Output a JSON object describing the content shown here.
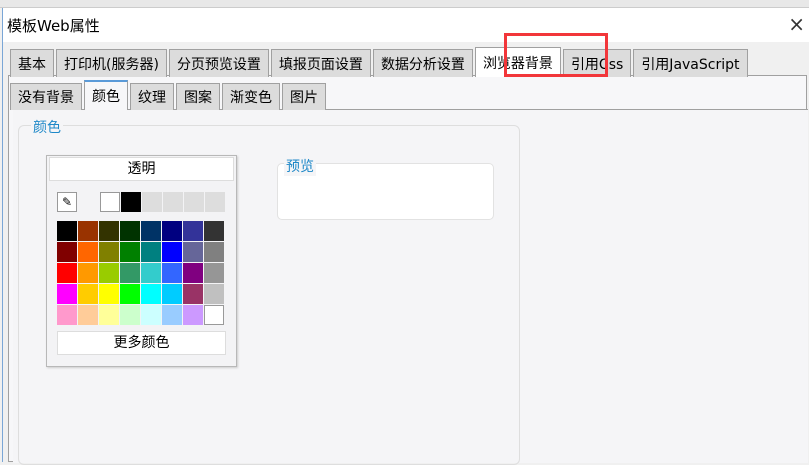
{
  "window": {
    "title": "模板Web属性",
    "close_icon": "×"
  },
  "outer_tabs": [
    {
      "label": "基本"
    },
    {
      "label": "打印机(服务器)"
    },
    {
      "label": "分页预览设置"
    },
    {
      "label": "填报页面设置"
    },
    {
      "label": "数据分析设置"
    },
    {
      "label": "浏览器背景",
      "active": true
    },
    {
      "label": "引用Css"
    },
    {
      "label": "引用JavaScript"
    }
  ],
  "inner_tabs": [
    {
      "label": "没有背景"
    },
    {
      "label": "颜色",
      "active": true
    },
    {
      "label": "纹理"
    },
    {
      "label": "图案"
    },
    {
      "label": "渐变色"
    },
    {
      "label": "图片"
    }
  ],
  "color_group": {
    "label": "颜色"
  },
  "picker": {
    "transparent_label": "透明",
    "eyedropper_icon": "eyedropper-icon",
    "recent_colors": [
      "#FFFFFF",
      "#000000",
      "#DDDDDD",
      "#DDDDDD",
      "#DDDDDD",
      "#DDDDDD"
    ],
    "palette": [
      "#000000",
      "#993300",
      "#333300",
      "#003300",
      "#003366",
      "#000080",
      "#333399",
      "#333333",
      "#800000",
      "#FF6600",
      "#808000",
      "#008000",
      "#008080",
      "#0000FF",
      "#666699",
      "#808080",
      "#FF0000",
      "#FF9900",
      "#99CC00",
      "#339966",
      "#33CCCC",
      "#3366FF",
      "#800080",
      "#969696",
      "#FF00FF",
      "#FFCC00",
      "#FFFF00",
      "#00FF00",
      "#00FFFF",
      "#00CCFF",
      "#993366",
      "#C0C0C0",
      "#FF99CC",
      "#FFCC99",
      "#FFFF99",
      "#CCFFCC",
      "#CCFFFF",
      "#99CCFF",
      "#CC99FF",
      "#FFFFFF"
    ],
    "more_label": "更多颜色"
  },
  "preview": {
    "label": "预览"
  },
  "highlight_color": "#F2363A"
}
